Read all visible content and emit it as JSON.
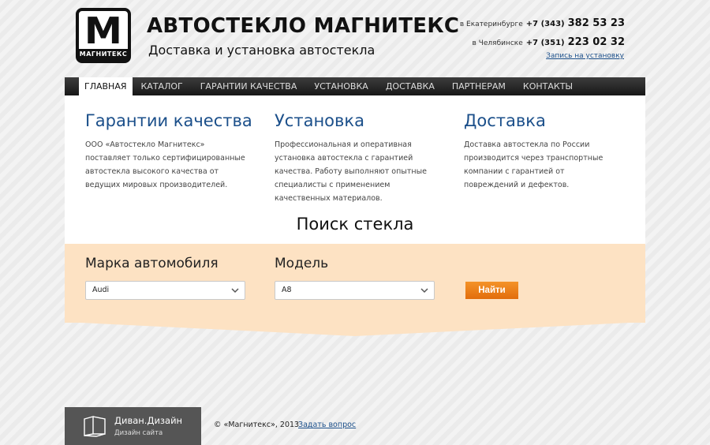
{
  "header": {
    "logo_letter": "M",
    "logo_text": "МАГНИТЕКС",
    "title": "АВТОСТЕКЛО МАГНИТЕКС",
    "subtitle": "Доставка и установка автостекла",
    "phones": [
      {
        "city": "в Екатеринбурге",
        "code": "+7 (343)",
        "number": "382 53 23"
      },
      {
        "city": "в Челябинске",
        "code": "+7 (351)",
        "number": "223 02 32"
      }
    ],
    "booking_link": "Запись на установку"
  },
  "nav": {
    "items": [
      {
        "label": "ГЛАВНАЯ",
        "active": true
      },
      {
        "label": "КАТАЛОГ",
        "active": false
      },
      {
        "label": "ГАРАНТИИ КАЧЕСТВА",
        "active": false
      },
      {
        "label": "УСТАНОВКА",
        "active": false
      },
      {
        "label": "ДОСТАВКА",
        "active": false
      },
      {
        "label": "ПАРТНЕРАМ",
        "active": false
      },
      {
        "label": "КОНТАКТЫ",
        "active": false
      }
    ]
  },
  "features": [
    {
      "title": "Гарантии качества",
      "text": "ООО «Автостекло Магнитекс» поставляет только сертифицированные автостекла высокого качества от ведущих мировых производителей."
    },
    {
      "title": "Установка",
      "text": "Профессиональная и оперативная установка автостекла с гарантией качества. Работу выполняют опытные специалисты с применением качественных материалов."
    },
    {
      "title": "Доставка",
      "text": "Доставка автостекла по России производится через транспортные компании с гарантией от повреждений и дефектов."
    }
  ],
  "search": {
    "title": "Поиск стекла",
    "make_label": "Марка автомобиля",
    "make_value": "Audi",
    "model_label": "Модель",
    "model_value": "A8",
    "button_label": "Найти"
  },
  "footer": {
    "dev_name": "Диван.Дизайн",
    "dev_sub": "Дизайн сайта",
    "copyright": "© «Магнитекс», 2013",
    "ask_link": "Задать вопрос"
  },
  "colors": {
    "accent": "#e8790f",
    "link": "#1b4f8a",
    "panel": "#fde2c3",
    "nav_bg": "#2a2a2a"
  }
}
